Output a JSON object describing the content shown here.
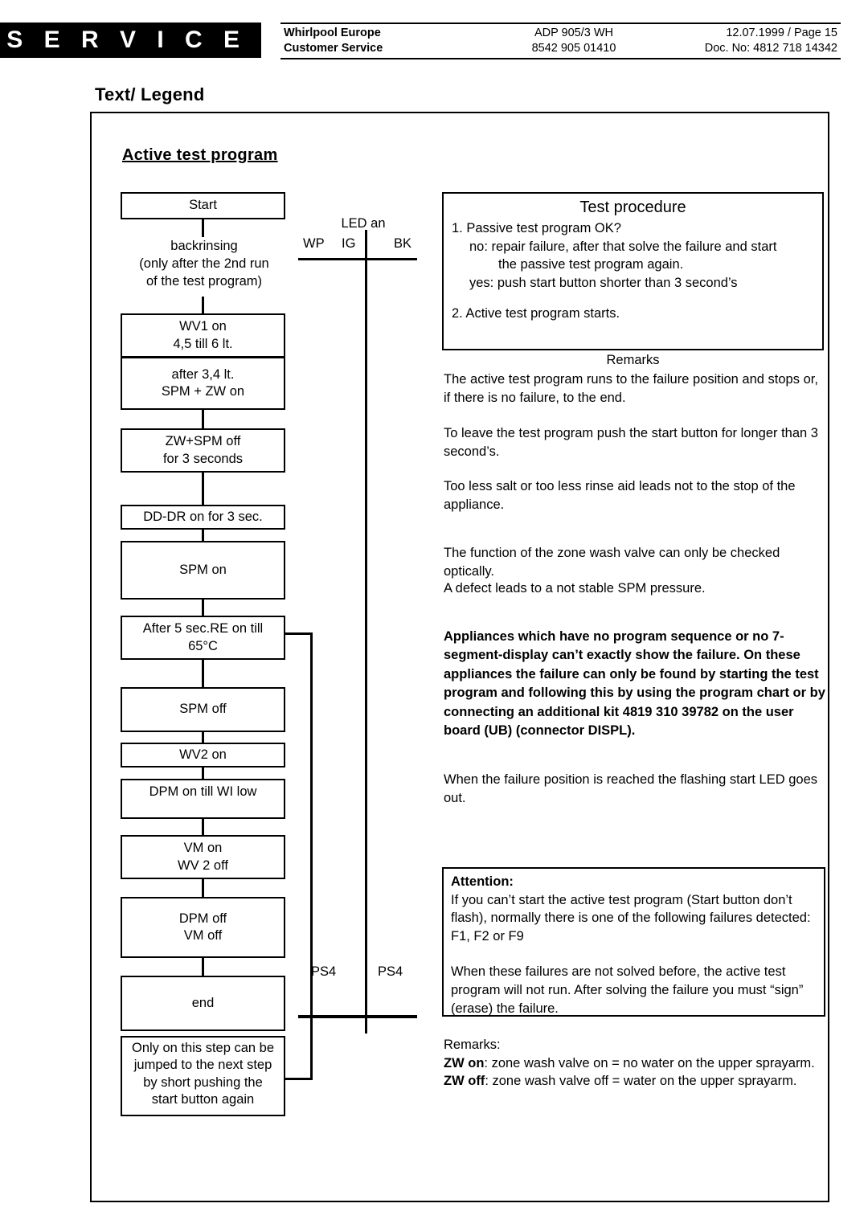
{
  "header": {
    "banner": "S E R V I C E",
    "company_line1": "Whirlpool Europe",
    "company_line2": "Customer Service",
    "model": "ADP 905/3 WH",
    "code": "8542 905 01410",
    "date_page": "12.07.1999 / Page 15",
    "doc_no": "Doc. No: 4812 718 14342"
  },
  "title": "Text/ Legend",
  "section_heading": "Active test program",
  "flowchart": {
    "steps": [
      {
        "id": "start",
        "type": "box",
        "lines": [
          "Start"
        ]
      },
      {
        "id": "backrinsing",
        "type": "text",
        "lines": [
          "backrinsing",
          "(only after the 2nd run",
          "of the test program)"
        ]
      },
      {
        "id": "wv1",
        "type": "box",
        "lines": [
          "WV1 on",
          "4,5 till 6 lt."
        ]
      },
      {
        "id": "after34",
        "type": "box",
        "lines": [
          "after 3,4 lt.",
          "SPM + ZW on"
        ]
      },
      {
        "id": "zw-spm-off",
        "type": "box",
        "lines": [
          "ZW+SPM off",
          "for 3 seconds"
        ]
      },
      {
        "id": "dd-dr",
        "type": "box",
        "lines": [
          "DD-DR on for 3 sec."
        ]
      },
      {
        "id": "spm-on",
        "type": "box",
        "lines": [
          "SPM on"
        ]
      },
      {
        "id": "re-on",
        "type": "box",
        "lines": [
          "After 5 sec.RE on till",
          "65°C"
        ]
      },
      {
        "id": "spm-off",
        "type": "box",
        "lines": [
          "SPM off"
        ]
      },
      {
        "id": "wv2-on",
        "type": "box",
        "lines": [
          "WV2 on"
        ]
      },
      {
        "id": "dpm-on",
        "type": "box",
        "lines": [
          "DPM on till WI low"
        ]
      },
      {
        "id": "vm-on",
        "type": "box",
        "lines": [
          "VM on",
          "WV 2 off"
        ]
      },
      {
        "id": "dpm-off",
        "type": "box",
        "lines": [
          "DPM off",
          "VM off"
        ]
      },
      {
        "id": "end",
        "type": "box",
        "lines": [
          "end"
        ]
      },
      {
        "id": "note",
        "type": "box",
        "lines": [
          "Only on this step can be",
          "jumped to the next step",
          "by short pushing the",
          "start button again"
        ]
      }
    ]
  },
  "led_column": {
    "title": "LED an",
    "col_wp": "WP",
    "col_ig": "IG",
    "col_bk": "BK",
    "ps4_left": "PS4",
    "ps4_right": "PS4"
  },
  "test_procedure": {
    "title": "Test procedure",
    "l1": "1. Passive test program OK?",
    "l2": "no: repair failure, after that solve the failure and start",
    "l3": "the passive test program again.",
    "l4": "yes: push start button shorter than 3 second’s",
    "l5": "2. Active test program starts."
  },
  "remarks": {
    "title": "Remarks",
    "p1": "The active test program runs to the failure position and stops or, if there is no failure, to the end.",
    "p2": "To leave the test program push the start button for longer than 3 second’s.",
    "p3": "Too less salt or too less rinse aid leads not to the stop of the appliance.",
    "p4a": "The function of the zone wash valve can only be checked optically.",
    "p4b": "A defect leads to a not stable SPM pressure.",
    "p5_bold": "Appliances which have no program sequence or no 7-segment-display can’t exactly show the failure. On these appliances the failure can only be found by starting the test program and following this by using the program chart or by connecting an additional kit 4819 310 39782 on the user board (UB) (connector DISPL).",
    "p6": "When the failure position is reached the flashing start LED goes out."
  },
  "attention": {
    "title": "Attention:",
    "p1": "If you can’t start the active test program (Start button don’t flash), normally there is one of the following failures detected: F1, F2 or F9",
    "p2": "When these failures are not solved before, the active test program will not run. After solving the failure you must “sign” (erase) the failure."
  },
  "bottom_remarks": {
    "title": "Remarks:",
    "zw_on_label": "ZW on",
    "zw_on_text": ": zone wash valve on = no water on the upper sprayarm.",
    "zw_off_label": "ZW off",
    "zw_off_text": ": zone wash valve off = water on the upper sprayarm."
  }
}
